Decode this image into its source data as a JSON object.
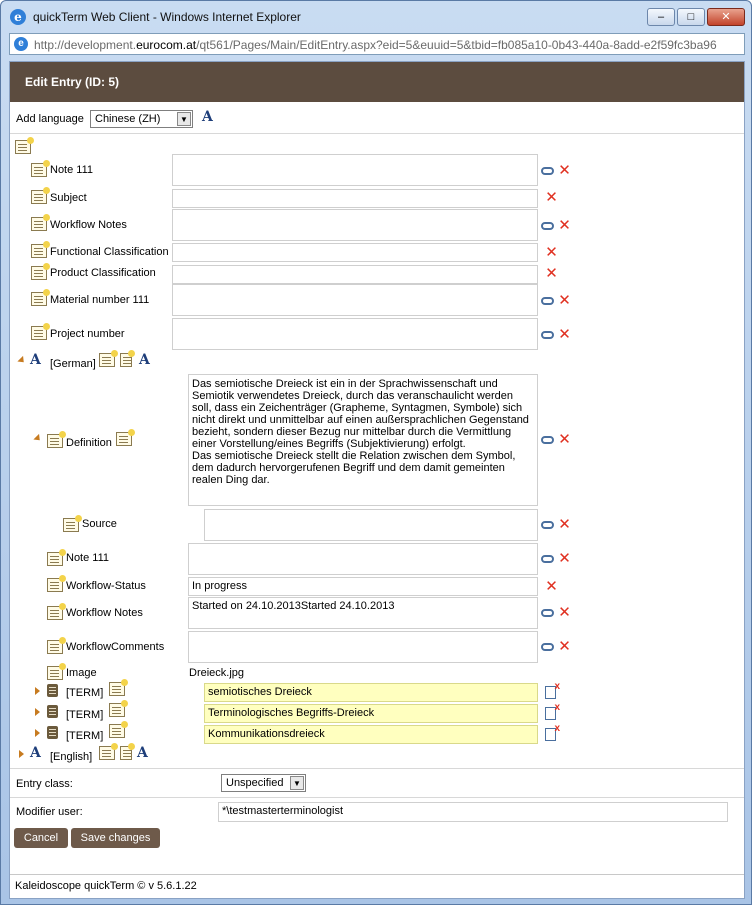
{
  "window": {
    "title": "quickTerm Web Client - Windows Internet Explorer",
    "url_prefix": "http://development.",
    "url_domain": "eurocom.at",
    "url_suffix": "/qt561/Pages/Main/EditEntry.aspx?eid=5&euuid=5&tbid=fb085a10-0b43-440a-8add-e2f59fc3ba96"
  },
  "header": {
    "title": "Edit Entry (ID: 5)"
  },
  "add_language": {
    "label": "Add language",
    "selected": "Chinese (ZH)"
  },
  "entry_fields": [
    {
      "label": "Note 111",
      "value": ""
    },
    {
      "label": "Subject",
      "value": ""
    },
    {
      "label": "Workflow Notes",
      "value": ""
    },
    {
      "label": "Functional Classification",
      "value": ""
    },
    {
      "label": "Product Classification",
      "value": ""
    },
    {
      "label": "Material number 111",
      "value": ""
    },
    {
      "label": "Project number",
      "value": ""
    }
  ],
  "german": {
    "label": "[German]",
    "definition_label": "Definition",
    "definition_text": "Das semiotische Dreieck ist ein in der Sprachwissenschaft und Semiotik verwendetes Dreieck, durch das veranschaulicht werden soll, dass ein Zeichenträger (Grapheme, Syntagmen, Symbole) sich nicht direkt und unmittelbar auf einen außersprachlichen Gegenstand bezieht, sondern dieser Bezug nur mittelbar durch die Vermittlung einer Vorstellung/eines Begriffs (Subjektivierung) erfolgt.\nDas semiotische Dreieck stellt die Relation zwischen dem Symbol, dem dadurch hervorgerufenen Begriff und dem damit gemeinten realen Ding dar.",
    "source_label": "Source",
    "source_value": "",
    "note_label": "Note 111",
    "note_value": "",
    "workflow_status_label": "Workflow-Status",
    "workflow_status_value": "In progress",
    "workflow_notes_label": "Workflow Notes",
    "workflow_notes_value": "Started on 24.10.2013Started 24.10.2013",
    "workflow_comments_label": "WorkflowComments",
    "workflow_comments_value": "",
    "image_label": "Image",
    "image_value": "Dreieck.jpg",
    "terms": [
      {
        "label": "[TERM]",
        "value": "semiotisches Dreieck"
      },
      {
        "label": "[TERM]",
        "value": "Terminologisches Begriffs-Dreieck"
      },
      {
        "label": "[TERM]",
        "value": "Kommunikationsdreieck"
      }
    ]
  },
  "english": {
    "label": "[English]"
  },
  "entry_class": {
    "label": "Entry class:",
    "selected": "Unspecified"
  },
  "modifier_user": {
    "label": "Modifier user:",
    "value": "*\\testmasterterminologist"
  },
  "buttons": {
    "cancel": "Cancel",
    "save": "Save changes"
  },
  "footer": {
    "text": "Kaleidoscope quickTerm © v 5.6.1.22"
  }
}
